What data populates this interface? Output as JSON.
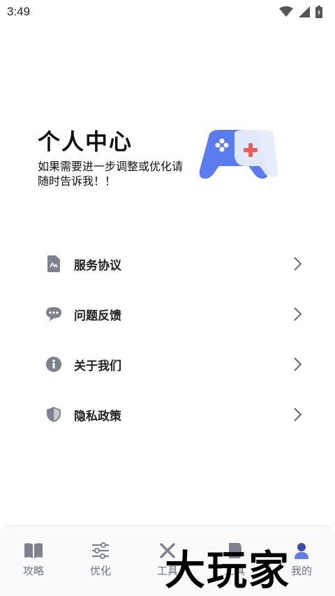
{
  "status_bar": {
    "time": "3:49"
  },
  "header": {
    "title": "个人中心",
    "subtitle": "如果需要进一步调整或优化请随时告诉我！！"
  },
  "menu": {
    "items": [
      {
        "label": "服务协议",
        "icon": "document-icon"
      },
      {
        "label": "问题反馈",
        "icon": "chat-bubble-icon"
      },
      {
        "label": "关于我们",
        "icon": "info-icon"
      },
      {
        "label": "隐私政策",
        "icon": "shield-icon"
      }
    ]
  },
  "tabbar": {
    "tabs": [
      {
        "label": "攻略",
        "icon": "book-icon"
      },
      {
        "label": "优化",
        "icon": "sliders-icon"
      },
      {
        "label": "工具",
        "icon": "tools-icon"
      },
      {
        "label": "工具",
        "icon": "tool-icon"
      },
      {
        "label": "我的",
        "icon": "profile-icon"
      }
    ]
  },
  "watermark": {
    "text": "大玩家"
  },
  "colors": {
    "accent_blue": "#5b7cf0",
    "accent_red": "#f05a5a",
    "icon_gray": "#7d838e",
    "tab_gray": "#6b7380"
  }
}
